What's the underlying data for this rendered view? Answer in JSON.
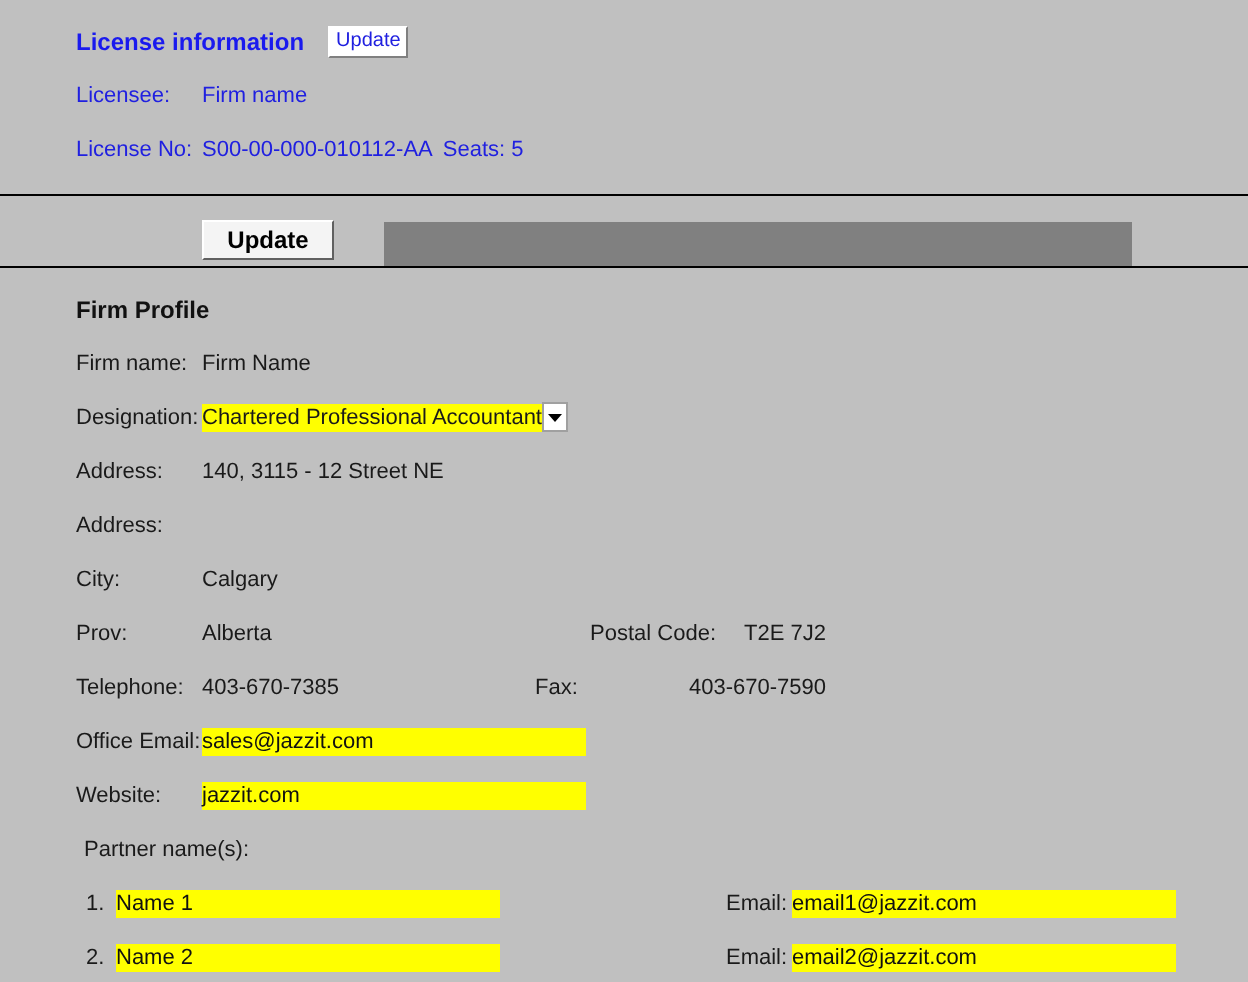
{
  "license": {
    "title": "License information",
    "update_button": "Update",
    "licensee_label": "Licensee:",
    "licensee": "Firm name",
    "license_no_label": "License No:",
    "license_no": "S00-00-000-010112-AA",
    "seats": "Seats: 5"
  },
  "update_button": "Update",
  "profile": {
    "title": "Firm Profile",
    "fields": [
      {
        "label": "Firm name:",
        "value": "Firm Name",
        "kind": "text"
      },
      {
        "label": "Designation:",
        "value": "Chartered Professional Accountant",
        "kind": "select"
      },
      {
        "label": "Address:",
        "value": "140, 3115 - 12 Street NE",
        "kind": "text"
      },
      {
        "label": "Address:",
        "kind": "text"
      },
      {
        "label": "City:",
        "value": "Calgary",
        "kind": "text"
      },
      {
        "label": "Prov:",
        "value": "Alberta",
        "kind": "text",
        "right": {
          "label": "Postal Code:",
          "value": "T2E 7J2"
        }
      },
      {
        "label": "Telephone:",
        "value": "403-670-7385",
        "kind": "text",
        "right": {
          "label": "Fax:",
          "value": "403-670-7590"
        }
      },
      {
        "label": "Office Email:",
        "value": "sales@jazzit.com",
        "kind": "input"
      },
      {
        "label": "Website:",
        "value": "jazzit.com",
        "kind": "input"
      }
    ]
  },
  "partners": {
    "label": "Partner name(s):",
    "items": [
      {
        "number": "1.",
        "name": "Name 1",
        "email_label": "Email:",
        "email": "email1@jazzit.com"
      },
      {
        "number": "2.",
        "name": "Name 2",
        "email_label": "Email:",
        "email": "email2@jazzit.com"
      }
    ]
  }
}
